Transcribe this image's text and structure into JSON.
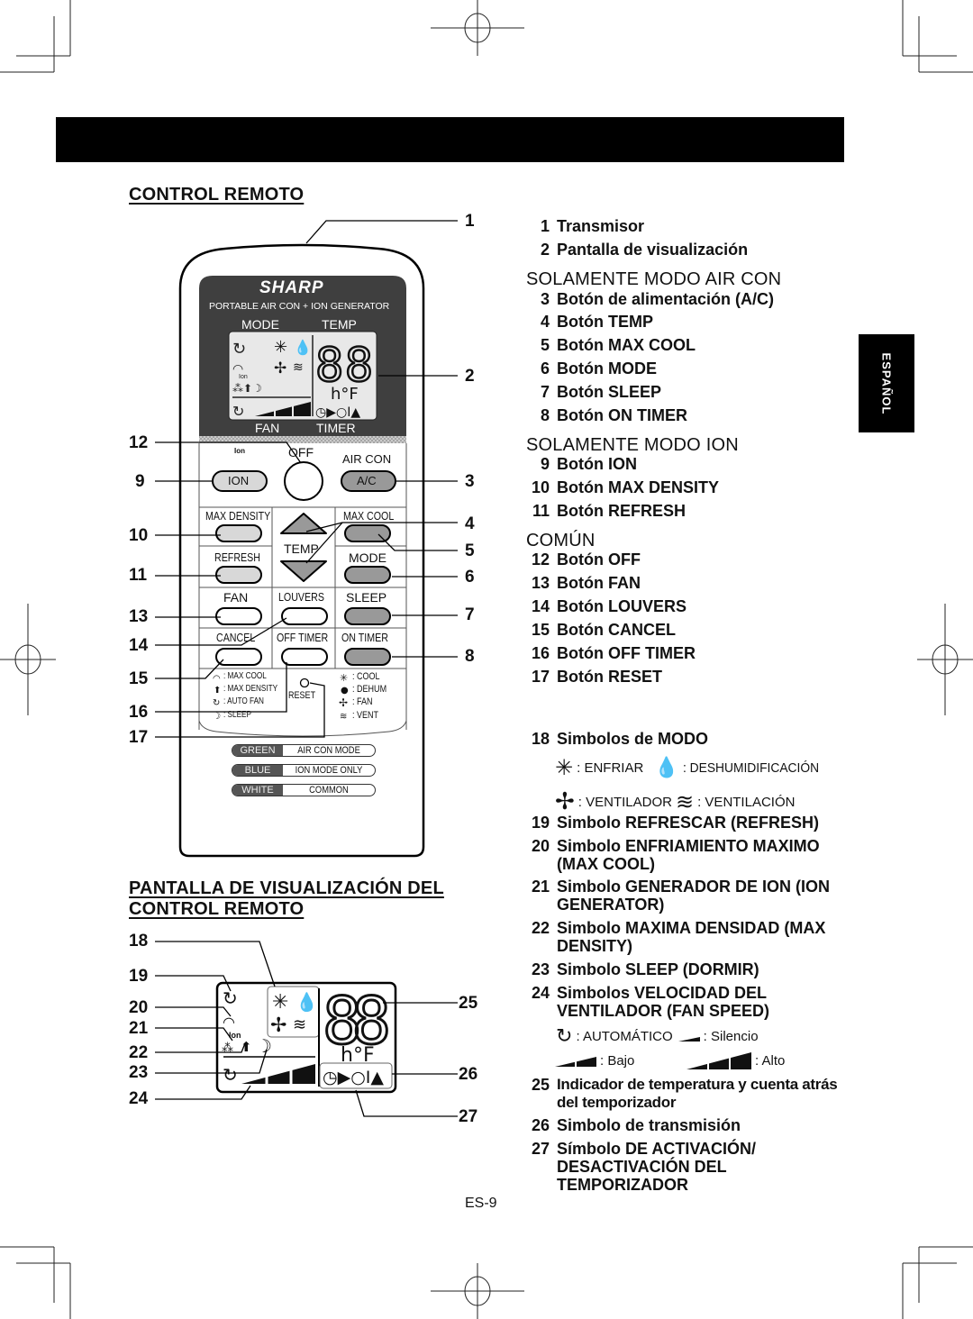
{
  "page": {
    "page_number": "ES-9",
    "language_tab": "ESPAÑOL"
  },
  "remote_section": {
    "title": "CONTROL REMOTO"
  },
  "display_section": {
    "title_line1": "PANTALLA DE VISUALIZACIÓN DEL",
    "title_line2": "CONTROL REMOTO"
  },
  "remote": {
    "brand": "SHARP",
    "subtitle": "PORTABLE AIR CON + ION GENERATOR",
    "lcd_top_labels": [
      "MODE",
      "TEMP"
    ],
    "lcd_bottom_labels": [
      "FAN",
      "TIMER"
    ],
    "lcd_digits": "88",
    "lcd_unit": "h°F",
    "buttons": {
      "ion_symbol": "Ion",
      "ion": "ION",
      "off": "OFF",
      "air_con": "AIR CON",
      "ac": "A/C",
      "max_density": "MAX DENSITY",
      "max_cool": "MAX COOL",
      "temp": "TEMP",
      "refresh": "REFRESH",
      "mode": "MODE",
      "fan": "FAN",
      "louvers": "LOUVERS",
      "sleep": "SLEEP",
      "cancel": "CANCEL",
      "off_timer": "OFF TIMER",
      "on_timer": "ON TIMER",
      "reset": "RESET"
    },
    "legend_left": [
      ": MAX COOL",
      ": MAX DENSITY",
      ": AUTO FAN",
      ": SLEEP"
    ],
    "legend_right": [
      ": COOL",
      ": DEHUM",
      ": FAN",
      ": VENT"
    ],
    "color_legend": [
      {
        "color": "GREEN",
        "desc": "AIR CON MODE ONLY"
      },
      {
        "color": "BLUE",
        "desc": "ION MODE ONLY"
      },
      {
        "color": "WHITE",
        "desc": "COMMON"
      }
    ]
  },
  "callouts_remote": [
    "1",
    "2",
    "3",
    "4",
    "5",
    "6",
    "7",
    "8",
    "9",
    "10",
    "11",
    "12",
    "13",
    "14",
    "15",
    "16",
    "17"
  ],
  "callouts_display": [
    "18",
    "19",
    "20",
    "21",
    "22",
    "23",
    "24",
    "25",
    "26",
    "27"
  ],
  "list": {
    "general": [
      {
        "num": "1",
        "text": "Transmisor"
      },
      {
        "num": "2",
        "text": "Pantalla de visualización"
      }
    ],
    "air_con": {
      "title": "SOLAMENTE MODO AIR CON",
      "items": [
        {
          "num": "3",
          "text": "Botón de alimentación (A/C)"
        },
        {
          "num": "4",
          "text": "Botón TEMP"
        },
        {
          "num": "5",
          "text": "Botón MAX COOL"
        },
        {
          "num": "6",
          "text": "Botón MODE"
        },
        {
          "num": "7",
          "text": "Botón SLEEP"
        },
        {
          "num": "8",
          "text": "Botón ON TIMER"
        }
      ]
    },
    "ion": {
      "title": "SOLAMENTE MODO ION",
      "items": [
        {
          "num": "9",
          "text": "Botón ION"
        },
        {
          "num": "10",
          "text": "Botón MAX DENSITY"
        },
        {
          "num": "11",
          "text": "Botón REFRESH"
        }
      ]
    },
    "common": {
      "title": "COMÚN",
      "items": [
        {
          "num": "12",
          "text": "Botón OFF"
        },
        {
          "num": "13",
          "text": "Botón FAN"
        },
        {
          "num": "14",
          "text": "Botón LOUVERS"
        },
        {
          "num": "15",
          "text": "Botón CANCEL"
        },
        {
          "num": "16",
          "text": "Botón OFF TIMER"
        },
        {
          "num": "17",
          "text": "Botón RESET"
        }
      ]
    },
    "symbols": [
      {
        "num": "18",
        "text": "Simbolos de MODO"
      },
      {
        "num": "19",
        "text": "Simbolo REFRESCAR (REFRESH)"
      },
      {
        "num": "20",
        "text": "Simbolo ENFRIAMIENTO MAXIMO (MAX COOL)"
      },
      {
        "num": "21",
        "text": "Simbolo GENERADOR DE ION (ION GENERATOR)"
      },
      {
        "num": "22",
        "text": "Simbolo MAXIMA DENSIDAD (MAX DENSITY)"
      },
      {
        "num": "23",
        "text": "Simbolo SLEEP (DORMIR)"
      },
      {
        "num": "24",
        "text": "Simbolos VELOCIDAD DEL VENTILADOR (FAN SPEED)"
      },
      {
        "num": "25",
        "text": "Indicador de temperatura y cuenta atrás del temporizador"
      },
      {
        "num": "26",
        "text": "Simbolo de transmisión"
      },
      {
        "num": "27",
        "text": "Símbolo DE ACTIVACIÓN/ DESACTIVACIÓN DEL TEMPORIZADOR"
      }
    ],
    "mode_symbols": [
      {
        "icon": "snowflake-icon",
        "label": ": ENFRIAR"
      },
      {
        "icon": "droplet-icon",
        "label": ": DESHUMIDIFICACIÓN"
      },
      {
        "icon": "fan-icon",
        "label": ": VENTILADOR"
      },
      {
        "icon": "vent-icon",
        "label": ": VENTILACIÓN"
      }
    ],
    "fan_speeds": [
      {
        "icon": "auto-fan-icon",
        "label": ": AUTOMÁTICO"
      },
      {
        "icon": "speed-1-icon",
        "label": ": Silencio"
      },
      {
        "icon": "speed-2-icon",
        "label": ": Bajo"
      },
      {
        "icon": "speed-3-icon",
        "label": ": Alto"
      }
    ]
  }
}
